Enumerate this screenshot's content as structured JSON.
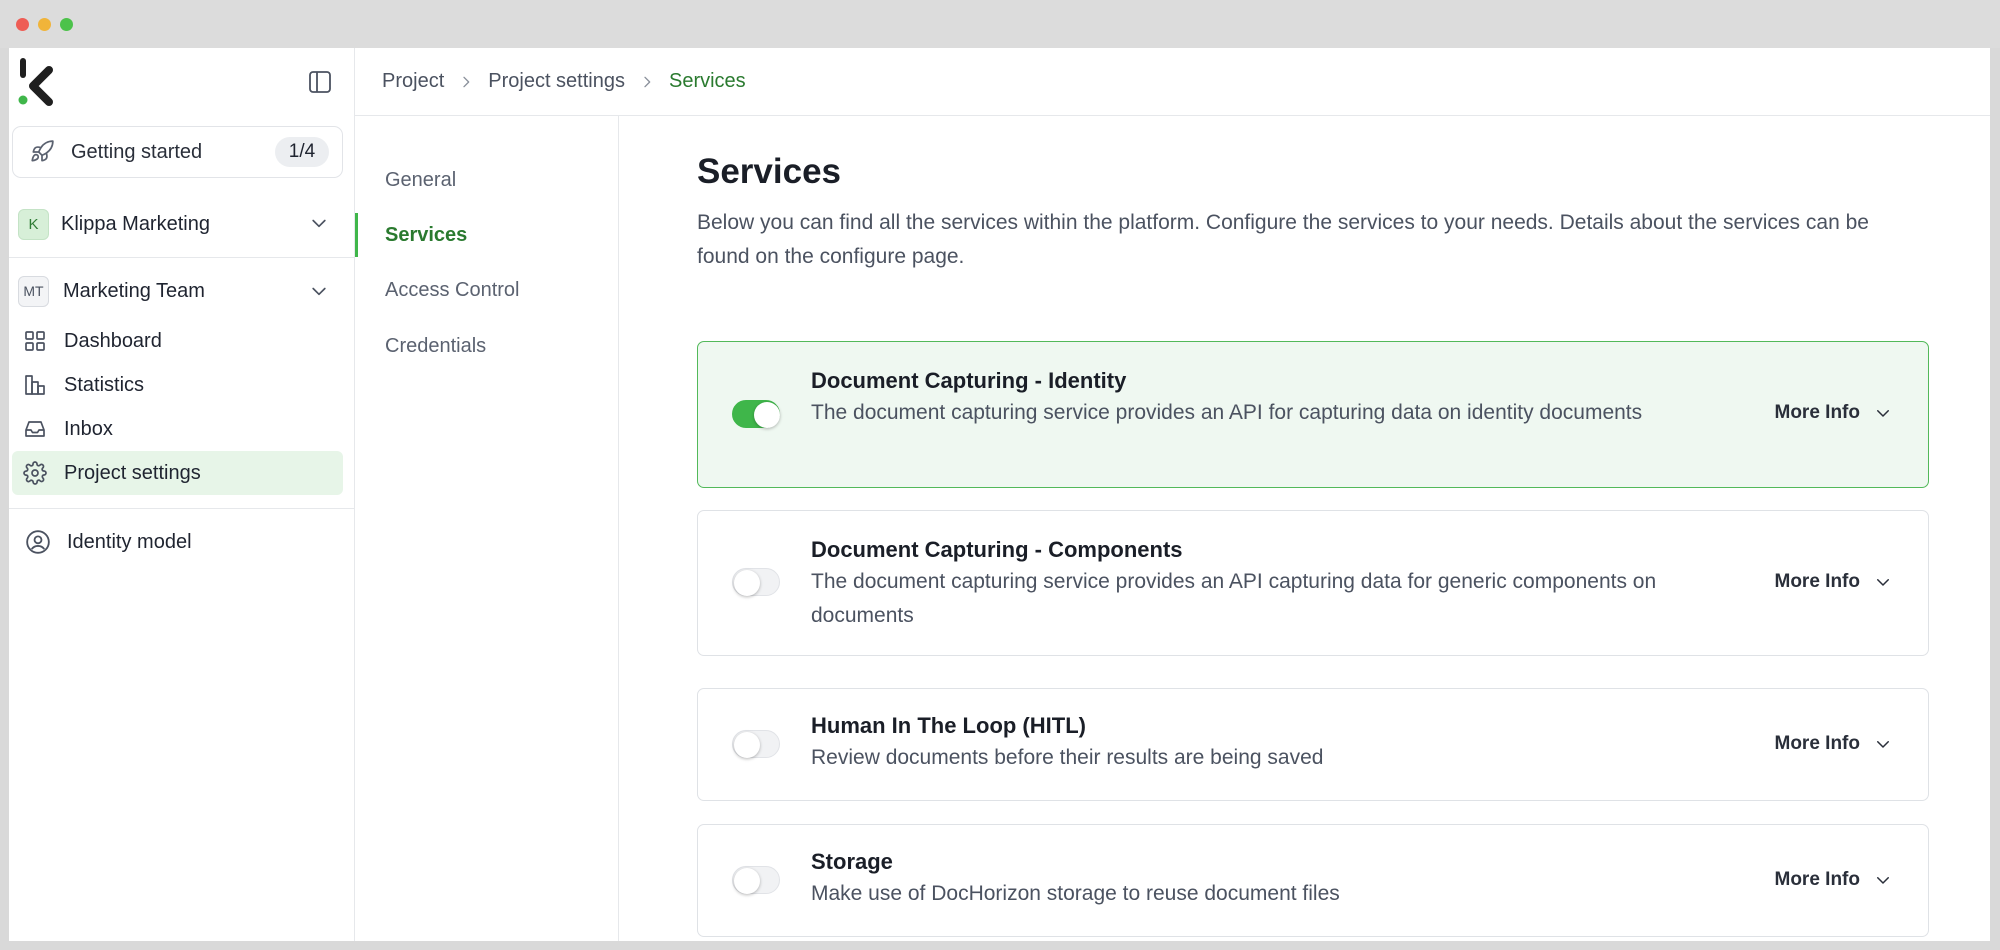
{
  "sidebar": {
    "getting_started": {
      "label": "Getting started",
      "badge": "1/4"
    },
    "organization": {
      "avatar": "K",
      "label": "Klippa Marketing"
    },
    "team": {
      "avatar": "MT",
      "label": "Marketing Team"
    },
    "nav": [
      {
        "label": "Dashboard",
        "icon": "grid-icon"
      },
      {
        "label": "Statistics",
        "icon": "bar-chart-icon"
      },
      {
        "label": "Inbox",
        "icon": "inbox-icon"
      },
      {
        "label": "Project settings",
        "icon": "gear-icon",
        "active": true
      }
    ],
    "identity_model": {
      "label": "Identity model",
      "icon": "user-circle-icon"
    }
  },
  "breadcrumb": [
    "Project",
    "Project settings",
    "Services"
  ],
  "subnav": [
    "General",
    "Services",
    "Access Control",
    "Credentials"
  ],
  "main": {
    "title": "Services",
    "description": "Below you can find all the services within the platform. Configure the services to your needs. Details about the services can be found on the configure page.",
    "more_info_label": "More Info",
    "services": [
      {
        "title": "Document Capturing - Identity",
        "description": "The document capturing service provides an API for capturing data on identity documents",
        "enabled": true
      },
      {
        "title": "Document Capturing - Components",
        "description": "The document capturing service provides an API capturing data for generic components on documents",
        "enabled": false
      },
      {
        "title": "Human In The Loop (HITL)",
        "description": "Review documents before their results are being saved",
        "enabled": false
      },
      {
        "title": "Storage",
        "description": "Make use of DocHorizon storage to reuse document files",
        "enabled": false
      }
    ]
  },
  "colors": {
    "accent": "#3fb64a",
    "accent_dark": "#2a7a2f",
    "active_bg": "#e7f5e8",
    "enabled_card_bg": "#eff8f1"
  }
}
